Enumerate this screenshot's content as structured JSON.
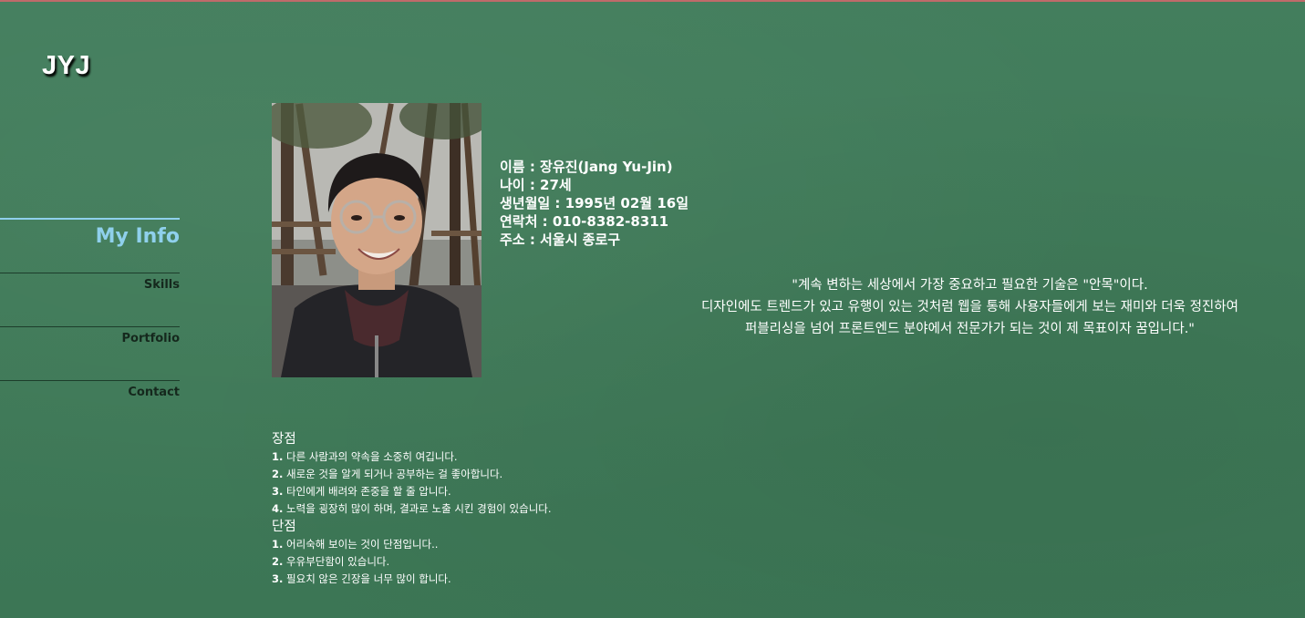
{
  "logo": "JYJ",
  "nav": {
    "items": [
      "My Info",
      "Skills",
      "Portfolio",
      "Contact"
    ],
    "active": "My Info"
  },
  "colors": {
    "background": "#407b59",
    "accent": "#8fd0ec",
    "nav_text": "#15281d"
  },
  "profile": {
    "photo_alt": "profile-photo",
    "fields": [
      {
        "label": "이름 : ",
        "value": "장유진(Jang Yu-Jin)"
      },
      {
        "label": "나이 : ",
        "value": "27세"
      },
      {
        "label": "생년월일 : ",
        "value": "1995년 02월 16일"
      },
      {
        "label": "연락처 : ",
        "value": "010-8382-8311"
      },
      {
        "label": "주소 : ",
        "value": "서울시 종로구"
      }
    ]
  },
  "quote": {
    "lines": [
      "\"계속 변하는 세상에서 가장 중요하고 필요한 기술은 \"안목\"이다.",
      "디자인에도 트렌드가 있고 유행이 있는 것처럼 웹을 통해 사용자들에게 보는 재미와 더욱 정진하여",
      "퍼블리싱을 넘어 프론트엔드 분야에서 전문가가 되는 것이 제 목표이자 꿈입니다.\""
    ]
  },
  "strengths": {
    "title": "장점",
    "items": [
      {
        "num": "1.",
        "text": " 다른 사람과의 약속을 소중히 여깁니다."
      },
      {
        "num": "2.",
        "text": " 새로운 것을 알게 되거나 공부하는 걸 좋아합니다."
      },
      {
        "num": "3.",
        "text": " 타인에게 배려와 존중을 할 줄 압니다."
      },
      {
        "num": "4.",
        "text": " 노력을 굉장히 많이 하며, 결과로 노출 시킨 경험이 있습니다."
      }
    ]
  },
  "weaknesses": {
    "title": "단점",
    "items": [
      {
        "num": "1.",
        "text": " 어리숙해 보이는 것이 단점입니다.."
      },
      {
        "num": "2.",
        "text": " 우유부단함이 있습니다."
      },
      {
        "num": "3.",
        "text": " 필요치 않은 긴장을 너무 많이 합니다."
      }
    ]
  }
}
